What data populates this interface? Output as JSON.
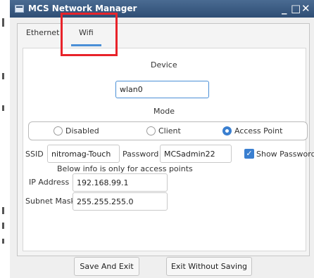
{
  "window": {
    "title": "MCS Network Manager",
    "minimize_glyph": "_",
    "restore_glyph": "□",
    "close_glyph": "✕"
  },
  "tabs": [
    {
      "label": "Ethernet",
      "selected": false
    },
    {
      "label": "Wifi",
      "selected": true
    }
  ],
  "device": {
    "label": "Device",
    "value": "wlan0"
  },
  "mode": {
    "label": "Mode",
    "options": [
      {
        "label": "Disabled",
        "selected": false
      },
      {
        "label": "Client",
        "selected": false
      },
      {
        "label": "Access Point",
        "selected": true
      }
    ]
  },
  "ssid": {
    "label": "SSID",
    "value": "nitromag-Touch"
  },
  "password": {
    "label": "Password",
    "value": "MCSadmin22"
  },
  "show_password": {
    "label": "Show Password",
    "checked": true,
    "check_glyph": "✓"
  },
  "ap_note": "Below info is only for access points",
  "ip_address": {
    "label": "IP Address",
    "value": "192.168.99.1"
  },
  "subnet_mask": {
    "label": "Subnet Mask",
    "value": "255.255.255.0"
  },
  "buttons": {
    "save": "Save And Exit",
    "exit": "Exit Without Saving"
  },
  "colors": {
    "titlebar": "#3b5a82",
    "accent": "#3a7fd0",
    "annotation": "#e8232a"
  }
}
